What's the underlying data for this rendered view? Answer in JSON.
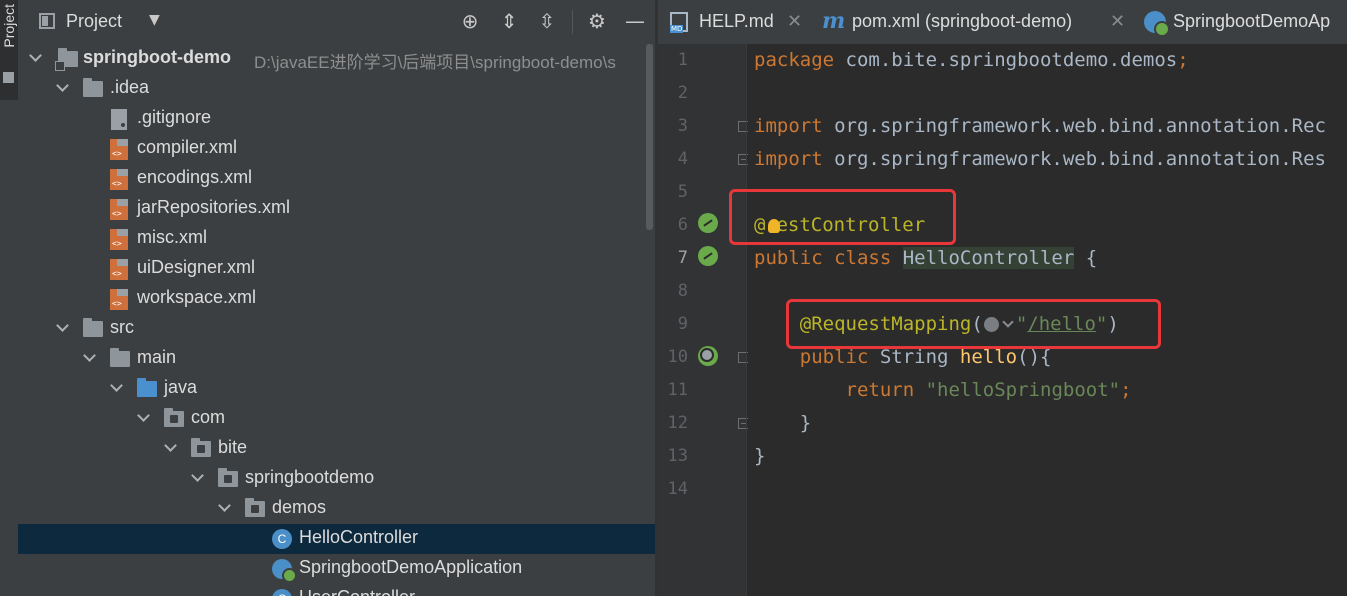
{
  "side_stripe": {
    "label": "Project"
  },
  "project_panel": {
    "title": "Project",
    "tree": [
      {
        "label": "springboot-demo",
        "path": "D:\\javaEE进阶学习\\后端项目\\springboot-demo\\s",
        "bold": true
      },
      {
        "label": ".idea"
      },
      {
        "label": ".gitignore"
      },
      {
        "label": "compiler.xml"
      },
      {
        "label": "encodings.xml"
      },
      {
        "label": "jarRepositories.xml"
      },
      {
        "label": "misc.xml"
      },
      {
        "label": "uiDesigner.xml"
      },
      {
        "label": "workspace.xml"
      },
      {
        "label": "src"
      },
      {
        "label": "main"
      },
      {
        "label": "java"
      },
      {
        "label": "com"
      },
      {
        "label": "bite"
      },
      {
        "label": "springbootdemo"
      },
      {
        "label": "demos"
      },
      {
        "label": "HelloController",
        "selected": true
      },
      {
        "label": "SpringbootDemoApplication"
      },
      {
        "label": "UserController"
      }
    ]
  },
  "editor": {
    "tabs": [
      {
        "label": "HELP.md"
      },
      {
        "label": "pom.xml (springboot-demo)"
      },
      {
        "label": "SpringbootDemoAp"
      }
    ],
    "line_numbers": [
      "1",
      "2",
      "3",
      "4",
      "5",
      "6",
      "7",
      "8",
      "9",
      "10",
      "11",
      "12",
      "13",
      "14"
    ],
    "code": {
      "l1": {
        "kw": "package",
        "rest": " com.bite.springbootdemo.demos",
        "semi": ";"
      },
      "l3": {
        "kw": "import",
        "rest": " org.springframework.web.bind.annotation.Rec"
      },
      "l4": {
        "kw": "import",
        "rest": " org.springframework.web.bind.annotation.Res"
      },
      "l6": {
        "at": "@",
        "rest": "estController"
      },
      "l7": {
        "kw1": "public",
        "kw2": " class ",
        "name": "HelloController",
        "brace": " {"
      },
      "l9": {
        "ann": "@RequestMapping",
        "open": "(",
        "q1": "\"",
        "url": "/hello",
        "q2": "\"",
        "close": ")"
      },
      "l10": {
        "kw": "public",
        "type": " String ",
        "fn": "hello",
        "rest": "(){"
      },
      "l11": {
        "kw": "return",
        "space": " ",
        "str": "\"helloSpringboot\"",
        "semi": ";"
      },
      "l12": {
        "brace": "}"
      },
      "l13": {
        "brace": "}"
      }
    }
  },
  "colors": {
    "keyword": "#cc7832",
    "annotation": "#bbb529",
    "string": "#6a8759",
    "function": "#ffc66d",
    "highlight_box": "#e8373b",
    "selection": "#0d293e"
  }
}
